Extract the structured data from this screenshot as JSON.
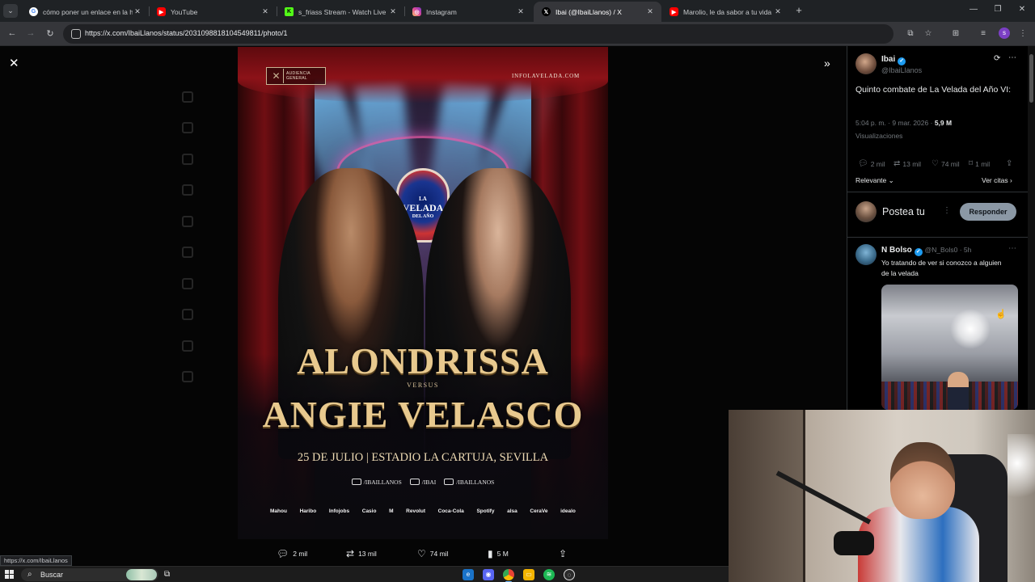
{
  "browser": {
    "tabs": [
      {
        "title": "cómo poner un enlace en la hi",
        "favicon": "google-icon",
        "color": "#ffffff"
      },
      {
        "title": "YouTube",
        "favicon": "youtube-icon",
        "color": "#ff0000"
      },
      {
        "title": "s_friass Stream - Watch Live on",
        "favicon": "kick-icon",
        "color": "#53fc18"
      },
      {
        "title": "Instagram",
        "favicon": "instagram-icon",
        "color": "#d6249f"
      },
      {
        "title": "Ibai (@IbaiLlanos) / X",
        "favicon": "x-icon",
        "color": "#000000",
        "active": true
      },
      {
        "title": "Marolio, le da sabor a tu vida (p",
        "favicon": "youtube-icon",
        "color": "#ff0000"
      }
    ],
    "url": "https://x.com/IbaiLlanos/status/2031098818104549811/photo/1",
    "status_url": "https://x.com/IbaiLlanos",
    "profile_initial": "s"
  },
  "poster": {
    "badge_line1": "AUDIENCIA",
    "badge_line2": "GENERAL",
    "site": "INFOLAVELADA.COM",
    "seal_line1": "LA",
    "seal_line2": "VELADA",
    "seal_line3": "DEL AÑO",
    "fighter1": "ALONDRISSA",
    "versus": "VERSUS",
    "fighter2": "ANGIE VELASCO",
    "date_venue": "25 DE JULIO | ESTADIO LA CARTUJA, SEVILLA",
    "handles": [
      "/IBAILLANOS",
      "/IBAI",
      "/IBAILLANOS"
    ],
    "sponsors": [
      "Mahou",
      "Haribo",
      "Infojobs",
      "Casio",
      "M",
      "Revolut",
      "Coca-Cola",
      "Spotify",
      "alsa",
      "CeraVe",
      "idealo"
    ]
  },
  "media_actions": {
    "replies": "2 mil",
    "reposts": "13 mil",
    "likes": "74 mil",
    "views": "5 M"
  },
  "tweet": {
    "author_name": "Ibai",
    "author_handle": "@IbaiLlanos",
    "text": "Quinto combate de La Velada del Año VI:",
    "time": "5:04 p. m. · 9 mar. 2026 ·",
    "views_count": "5,9 M",
    "views_label": "Visualizaciones",
    "replies": "2 mil",
    "reposts": "13 mil",
    "likes": "74 mil",
    "bookmarks": "1 mil",
    "sort_label": "Relevante",
    "quotes_label": "Ver citas",
    "compose_placeholder": "Postea tu",
    "reply_button": "Responder"
  },
  "reply": {
    "author_name": "N Bolso",
    "author_handle": "@N_Bols0",
    "time": "5h",
    "text": "Yo tratando de ver si conozco a alguien de la velada"
  },
  "taskbar": {
    "search_label": "Buscar",
    "apps": [
      "edge-icon",
      "discord-icon",
      "chrome-icon",
      "files-icon",
      "spotify-icon",
      "obs-icon"
    ]
  },
  "colors": {
    "accent": "#1d9bf0",
    "gold_text": "#e8c98e",
    "reply_button_bg": "#8b98a5"
  }
}
